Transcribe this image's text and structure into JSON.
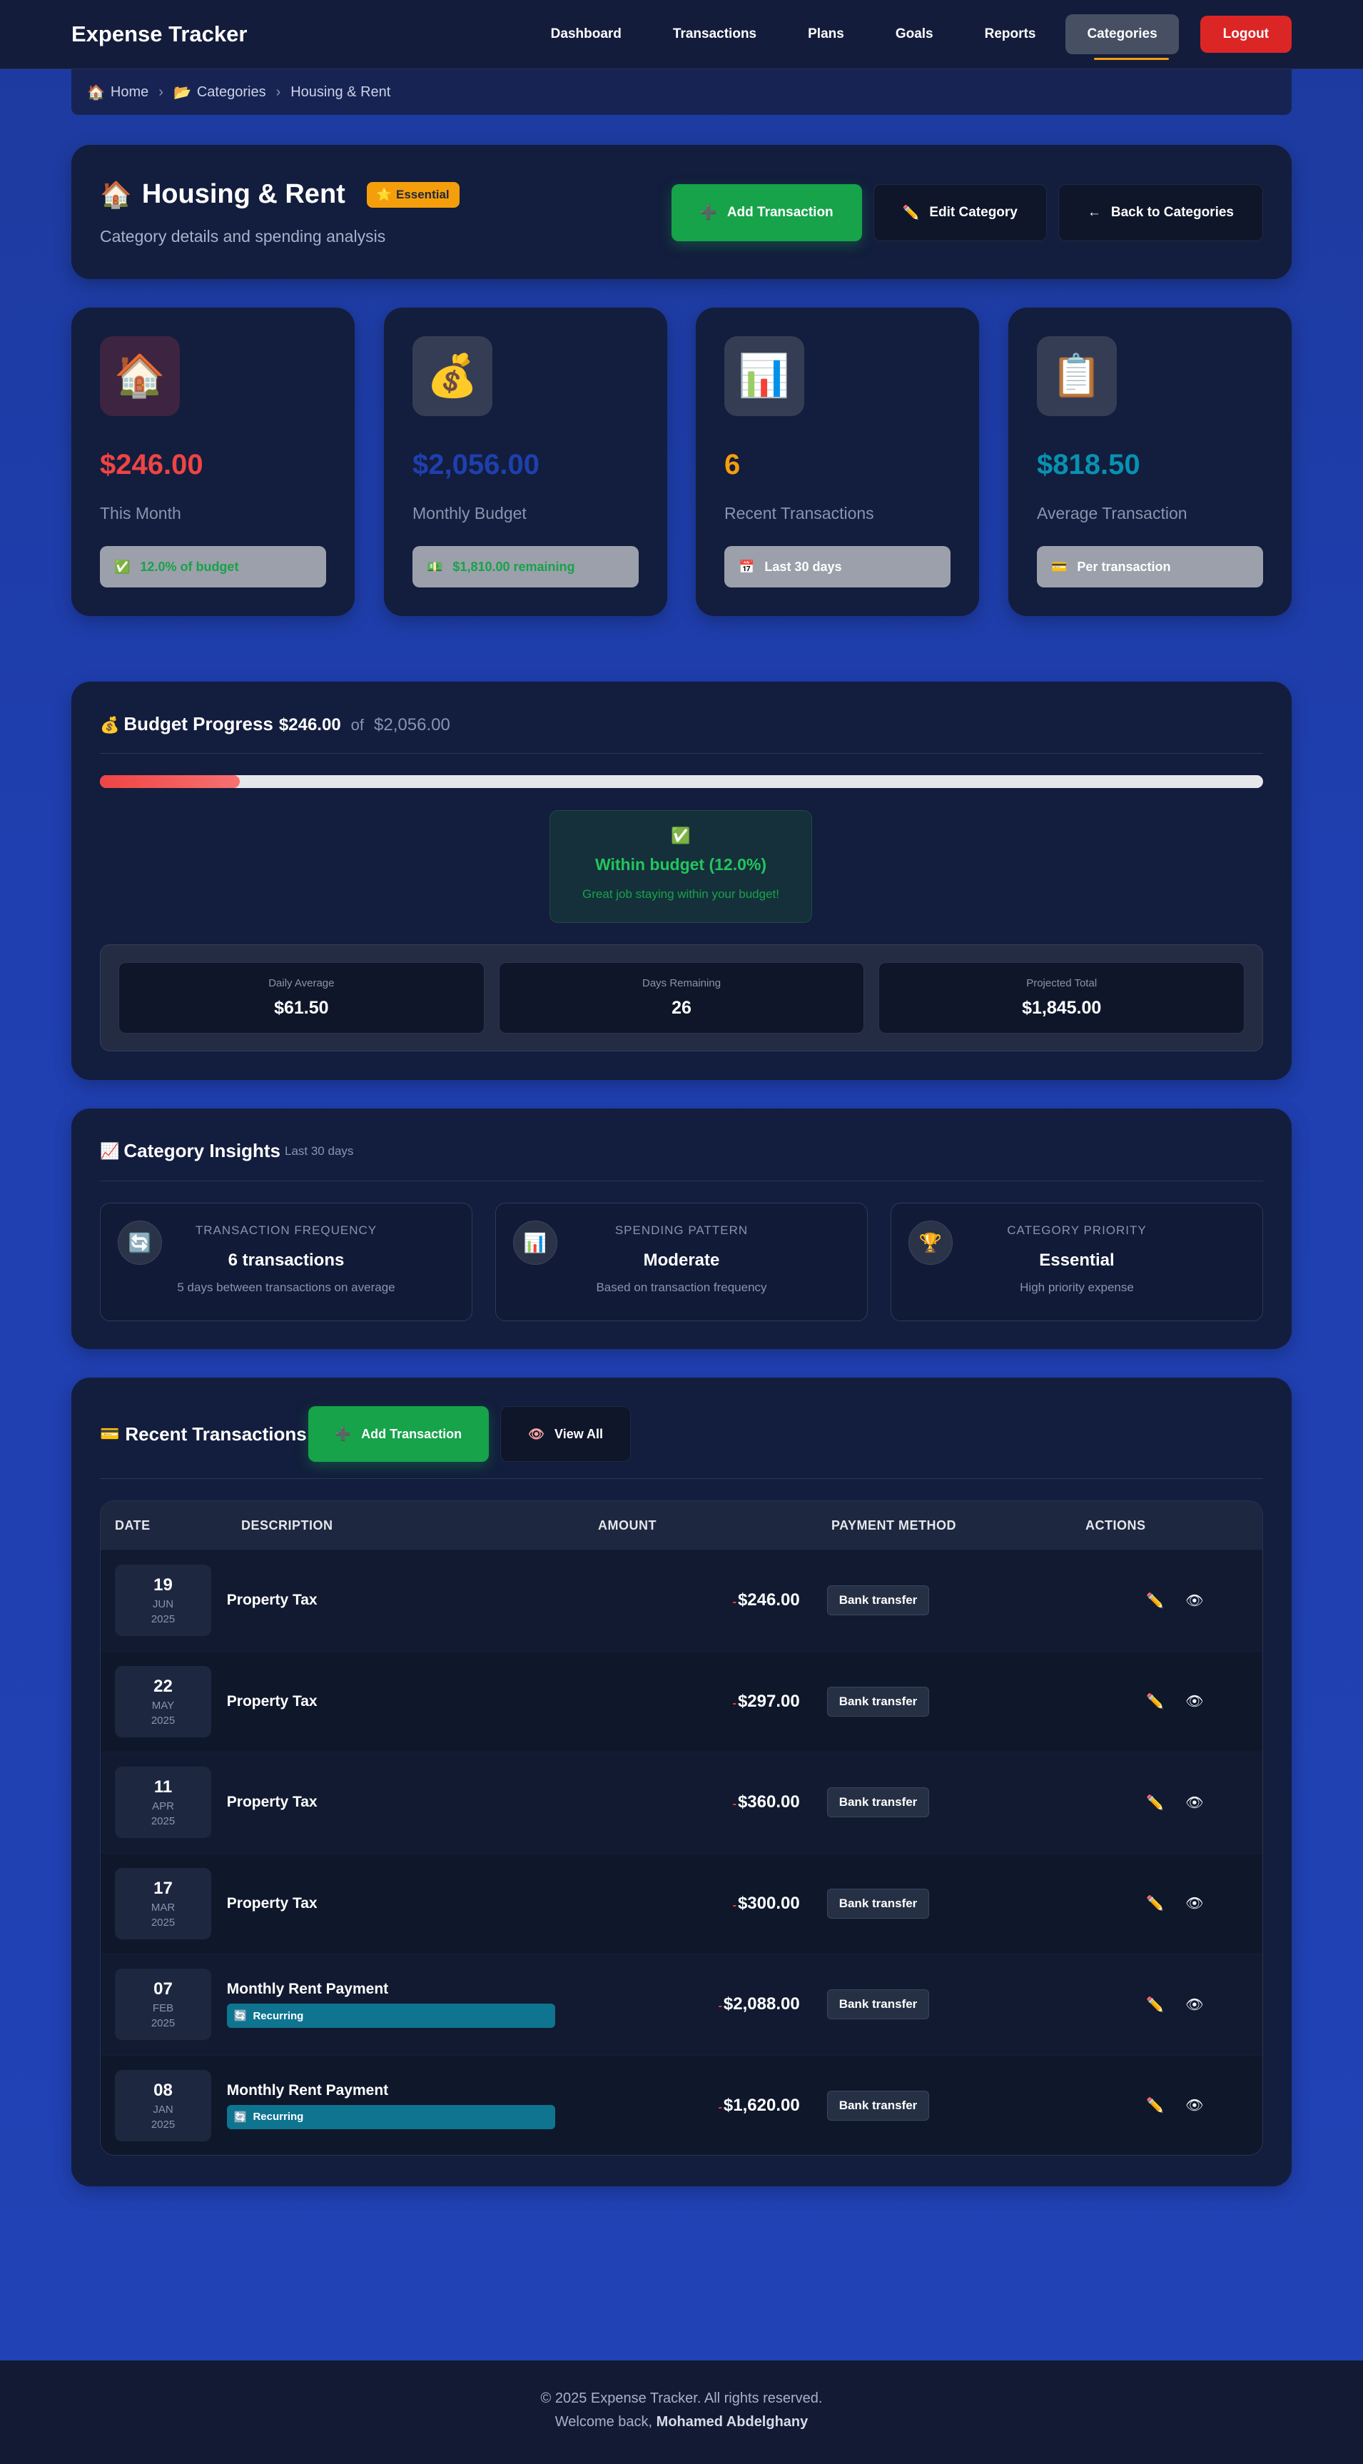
{
  "nav": {
    "brand": "Expense Tracker",
    "links": [
      "Dashboard",
      "Transactions",
      "Plans",
      "Goals",
      "Reports",
      "Categories"
    ],
    "active": "Categories",
    "logout": "Logout"
  },
  "breadcrumb": {
    "home_icon": "🏠",
    "home": "Home",
    "cat_icon": "📂",
    "categories": "Categories",
    "current": "Housing & Rent",
    "sep": "›"
  },
  "header": {
    "icon": "🏠",
    "title": "Housing & Rent",
    "badge_icon": "⭐",
    "badge": "Essential",
    "subtitle": "Category details and spending analysis",
    "add_icon": "➕",
    "add": "Add Transaction",
    "edit_icon": "✏️",
    "edit": "Edit Category",
    "back_icon": "←",
    "back": "Back to Categories"
  },
  "stats": [
    {
      "icon": "🏠",
      "value": "$246.00",
      "color": "#ef4444",
      "label": "This Month",
      "pill_icon": "✅",
      "pill": "12.0% of budget"
    },
    {
      "icon": "💰",
      "value": "$2,056.00",
      "color": "#1e40af",
      "label": "Monthly Budget",
      "pill_icon": "💵",
      "pill": "$1,810.00 remaining"
    },
    {
      "icon": "📊",
      "value": "6",
      "color": "#f59e0b",
      "label": "Recent Transactions",
      "pill_icon": "📅",
      "pill": "Last 30 days"
    },
    {
      "icon": "📋",
      "value": "$818.50",
      "color": "#0891b2",
      "label": "Average Transaction",
      "pill_icon": "💳",
      "pill": "Per transaction"
    }
  ],
  "budget": {
    "icon": "💰",
    "title": "Budget Progress",
    "spent": "$246.00",
    "of": "of",
    "total": "$2,056.00",
    "progress_pct": 12.0,
    "status_icon": "✅",
    "status": "Within budget (12.0%)",
    "status_note": "Great job staying within your budget!",
    "metrics": [
      {
        "label": "Daily Average",
        "value": "$61.50"
      },
      {
        "label": "Days Remaining",
        "value": "26"
      },
      {
        "label": "Projected Total",
        "value": "$1,845.00"
      }
    ]
  },
  "insights": {
    "icon": "📈",
    "title": "Category Insights",
    "period": "Last 30 days",
    "items": [
      {
        "icon": "🔄",
        "label": "TRANSACTION FREQUENCY",
        "value": "6 transactions",
        "desc": "5 days between transactions on average"
      },
      {
        "icon": "📊",
        "label": "SPENDING PATTERN",
        "value": "Moderate",
        "desc": "Based on transaction frequency"
      },
      {
        "icon": "🏆",
        "label": "CATEGORY PRIORITY",
        "value": "Essential",
        "desc": "High priority expense"
      }
    ]
  },
  "transactions": {
    "icon": "💳",
    "title": "Recent Transactions",
    "add_icon": "➕",
    "add": "Add Transaction",
    "view_icon": "👁",
    "view_all": "View All",
    "columns": [
      "DATE",
      "DESCRIPTION",
      "AMOUNT",
      "PAYMENT METHOD",
      "ACTIONS"
    ],
    "recurring_icon": "🔄",
    "recurring_label": "Recurring",
    "minus": "-",
    "edit_icon": "✏️",
    "eye_icon": "👁",
    "rows": [
      {
        "day": "19",
        "month": "JUN",
        "year": "2025",
        "desc": "Property Tax",
        "amount": "$246.00",
        "method": "Bank transfer",
        "recurring": false
      },
      {
        "day": "22",
        "month": "MAY",
        "year": "2025",
        "desc": "Property Tax",
        "amount": "$297.00",
        "method": "Bank transfer",
        "recurring": false
      },
      {
        "day": "11",
        "month": "APR",
        "year": "2025",
        "desc": "Property Tax",
        "amount": "$360.00",
        "method": "Bank transfer",
        "recurring": false
      },
      {
        "day": "17",
        "month": "MAR",
        "year": "2025",
        "desc": "Property Tax",
        "amount": "$300.00",
        "method": "Bank transfer",
        "recurring": false
      },
      {
        "day": "07",
        "month": "FEB",
        "year": "2025",
        "desc": "Monthly Rent Payment",
        "amount": "$2,088.00",
        "method": "Bank transfer",
        "recurring": true
      },
      {
        "day": "08",
        "month": "JAN",
        "year": "2025",
        "desc": "Monthly Rent Payment",
        "amount": "$1,620.00",
        "method": "Bank transfer",
        "recurring": true
      }
    ]
  },
  "footer": {
    "copyright": "© 2025 Expense Tracker. All rights reserved.",
    "welcome": "Welcome back,",
    "user": "Mohamed Abdelghany"
  }
}
